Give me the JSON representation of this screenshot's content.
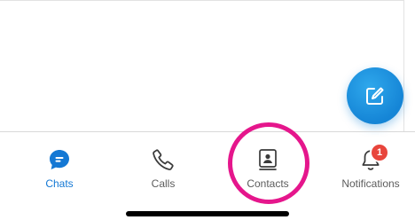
{
  "tabs": [
    {
      "id": "chats",
      "label": "Chats",
      "icon": "chat-bubble-icon",
      "active": true
    },
    {
      "id": "calls",
      "label": "Calls",
      "icon": "phone-icon",
      "active": false
    },
    {
      "id": "contacts",
      "label": "Contacts",
      "icon": "contacts-book-icon",
      "active": false
    },
    {
      "id": "notifications",
      "label": "Notifications",
      "icon": "bell-icon",
      "active": false
    }
  ],
  "notifications_badge": "1",
  "fab": {
    "icon": "compose-icon"
  },
  "colors": {
    "accent": "#1478d4",
    "fab": "#1a8ee0",
    "badge": "#e8453c",
    "highlight": "#e5168c",
    "inactive": "#5c5c5c"
  }
}
